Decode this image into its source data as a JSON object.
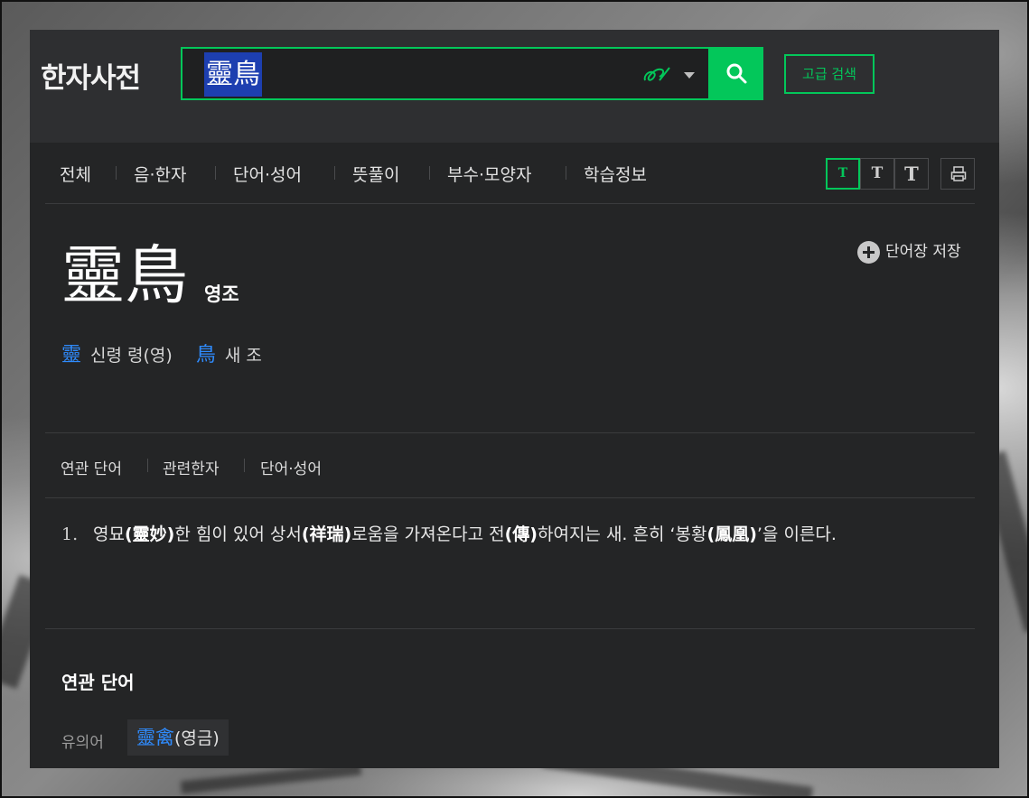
{
  "header": {
    "logo": "한자사전",
    "search_value": "靈鳥",
    "advanced_search": "고급 검색",
    "accent_color": "#03c75a"
  },
  "tabs": [
    "전체",
    "음·한자",
    "단어·성어",
    "뜻풀이",
    "부수·모양자",
    "학습정보"
  ],
  "font_size_buttons": [
    "T",
    "T",
    "T"
  ],
  "entry": {
    "word": "靈鳥",
    "reading": "영조",
    "save_label": "단어장 저장",
    "characters": [
      {
        "hanja": "靈",
        "meaning": "신령 령(영)"
      },
      {
        "hanja": "鳥",
        "meaning": "새 조"
      }
    ]
  },
  "related_nav": [
    "연관 단어",
    "관련한자",
    "단어·성어"
  ],
  "definition": {
    "number": "1.",
    "parts": [
      {
        "t": "영묘",
        "b": false
      },
      {
        "t": "(靈妙)",
        "b": true
      },
      {
        "t": "한 힘이 있어 상서",
        "b": false
      },
      {
        "t": "(祥瑞)",
        "b": true
      },
      {
        "t": "로움을 가져온다고 전",
        "b": false
      },
      {
        "t": "(傳)",
        "b": true
      },
      {
        "t": "하여지는 새. 흔히 ‘봉황",
        "b": false
      },
      {
        "t": "(鳳凰)",
        "b": true
      },
      {
        "t": "’을 이른다.",
        "b": false
      }
    ]
  },
  "related_words": {
    "heading": "연관 단어",
    "synonym_label": "유의어",
    "synonym_hanja": "靈禽",
    "synonym_reading": "(영금)"
  }
}
